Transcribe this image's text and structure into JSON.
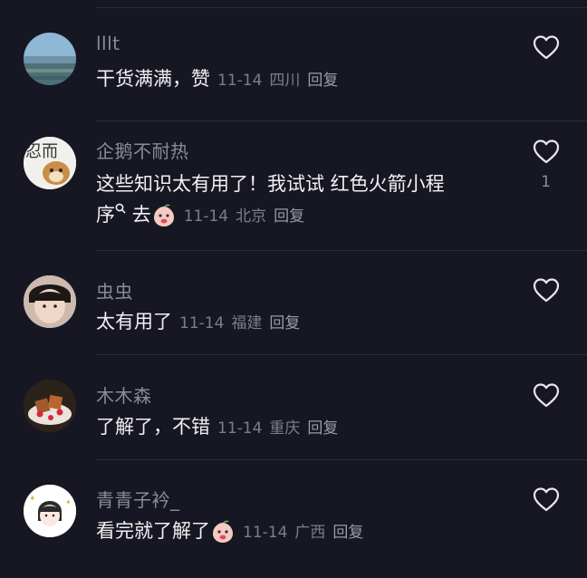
{
  "comments": [
    {
      "user": "lllt",
      "text": "干货满满，赞",
      "date": "11-14",
      "location": "四川",
      "reply": "回复",
      "likes": ""
    },
    {
      "user": "企鹅不耐热",
      "text_line1": "这些知识太有用了！我试试 红色火箭小程",
      "text_line2": "序",
      "text_tail": "去",
      "date": "11-14",
      "location": "北京",
      "reply": "回复",
      "likes": "1"
    },
    {
      "user": "虫虫",
      "text": "太有用了",
      "date": "11-14",
      "location": "福建",
      "reply": "回复",
      "likes": ""
    },
    {
      "user": "木木森",
      "text": "了解了，不错",
      "date": "11-14",
      "location": "重庆",
      "reply": "回复",
      "likes": ""
    },
    {
      "user": "青青子衿_",
      "text": "看完就了解了",
      "date": "11-14",
      "location": "广西",
      "reply": "回复",
      "likes": ""
    }
  ],
  "avatar_texts": {
    "c2": "忍而"
  },
  "icons": {
    "like": "heart-outline-icon",
    "search": "search-icon",
    "emoji": "peach-face-emoji"
  },
  "colors": {
    "background": "#161722",
    "username": "#8a8b93",
    "text": "#f1f1f3",
    "meta": "#7d7e86"
  }
}
